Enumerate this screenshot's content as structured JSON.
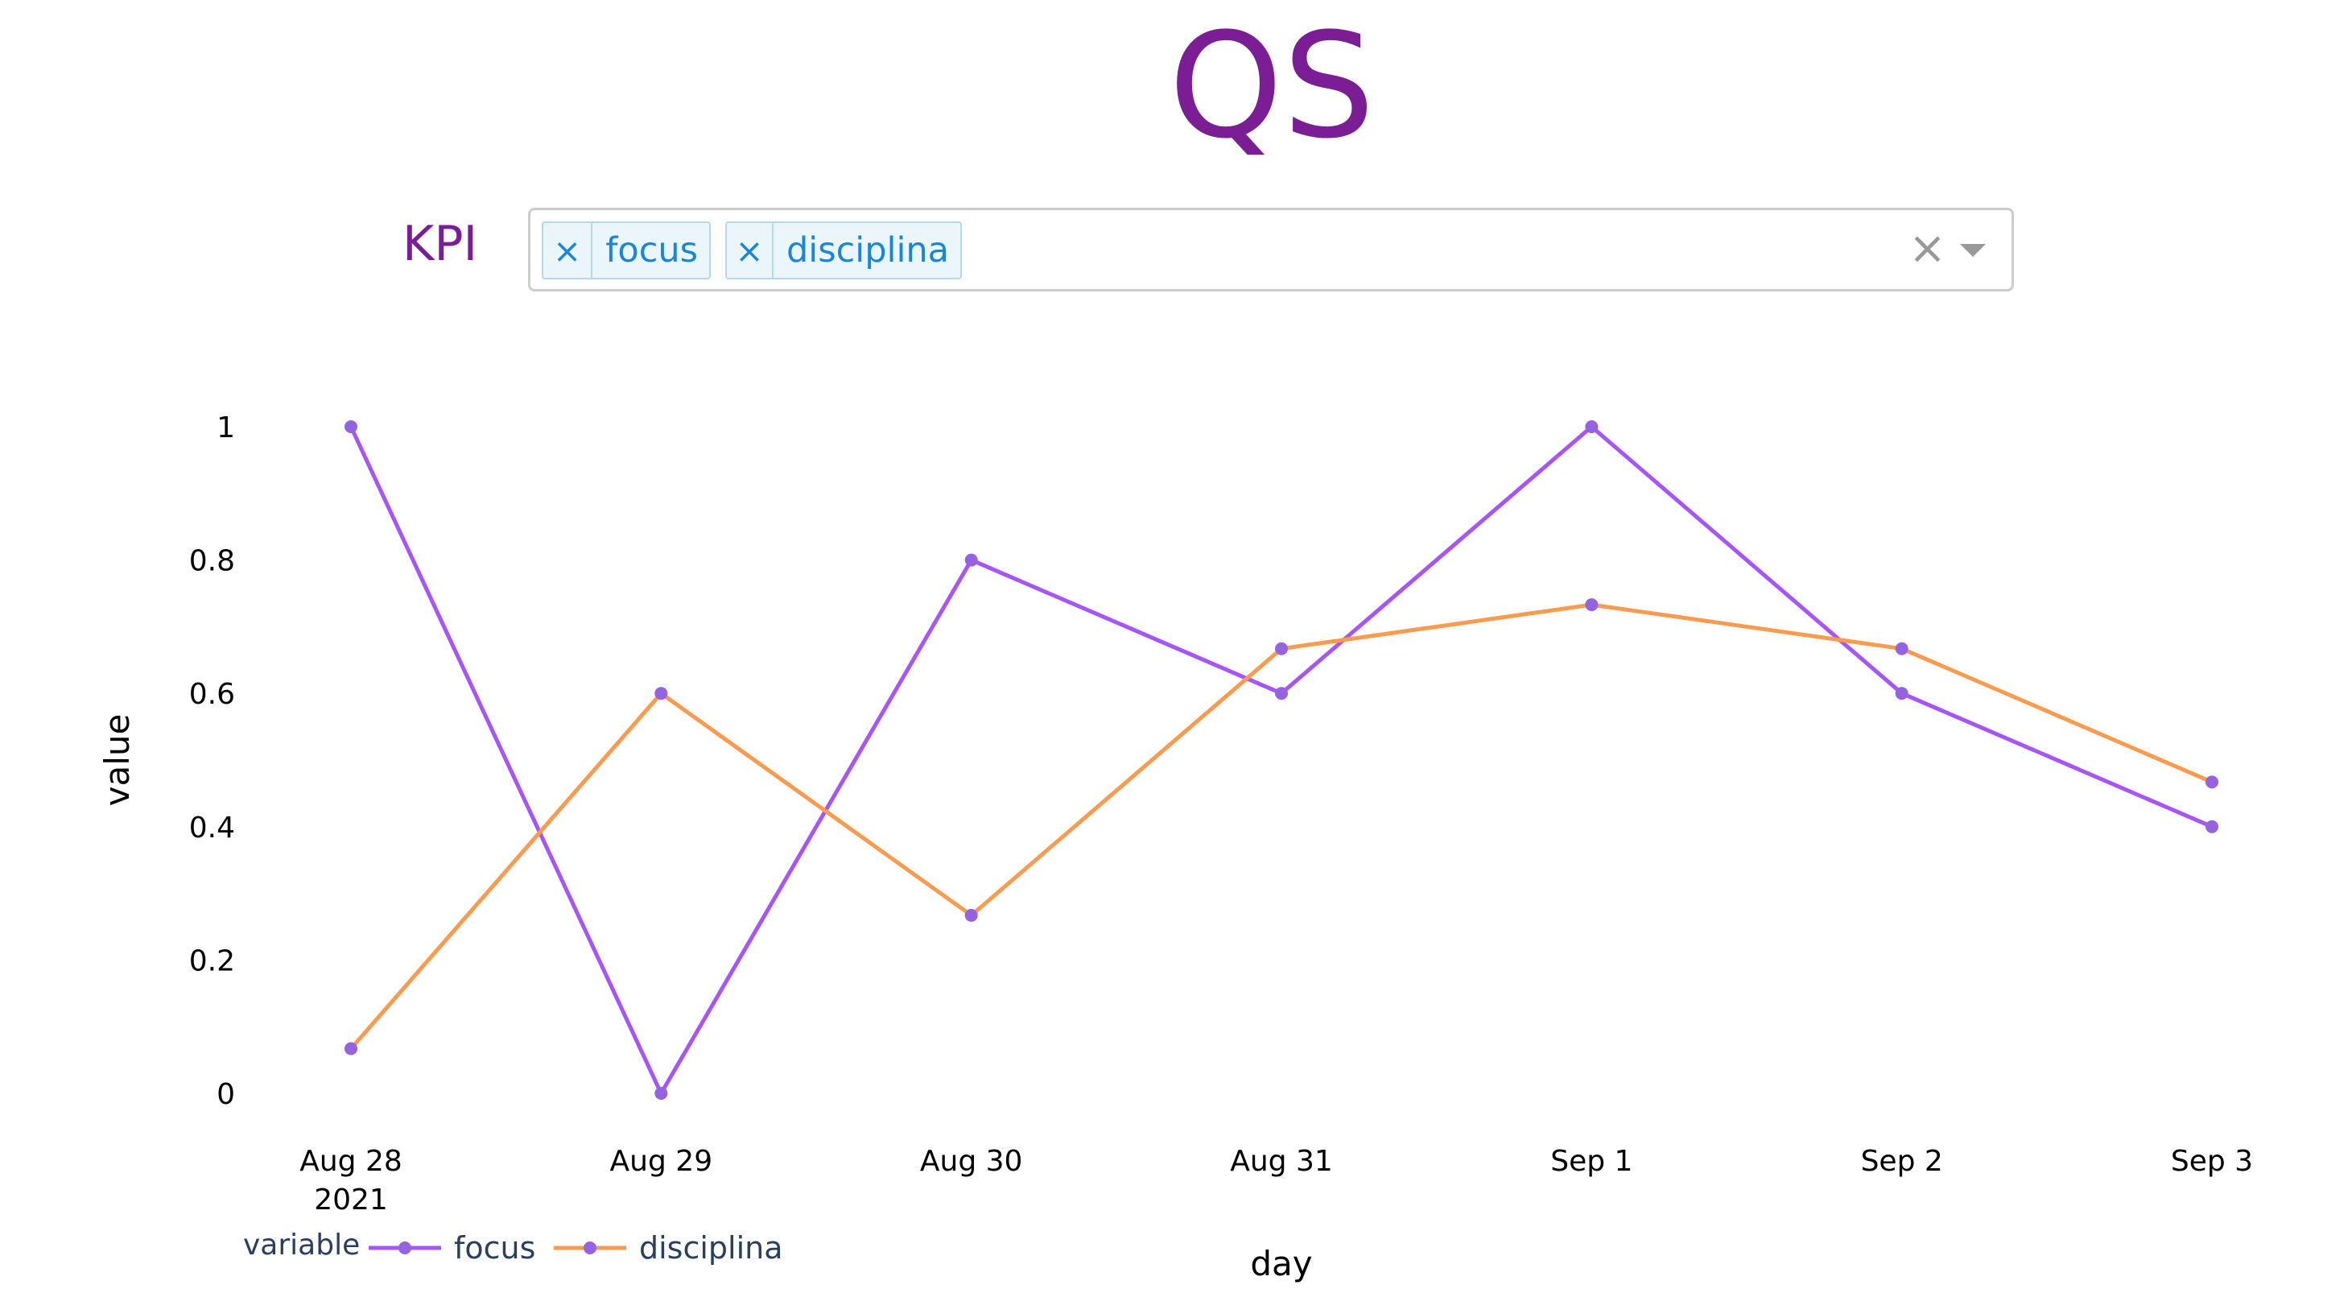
{
  "header": {
    "title": "QS"
  },
  "kpi_filter": {
    "label": "KPI",
    "selected": [
      {
        "label": "focus",
        "remove_glyph": "×"
      },
      {
        "label": "disciplina",
        "remove_glyph": "×"
      }
    ],
    "clear_glyph": "×",
    "clear_icon": "close-icon",
    "dropdown_icon": "caret-down-icon"
  },
  "chart_data": {
    "type": "line",
    "title": "",
    "xlabel": "day",
    "ylabel": "value",
    "categories": [
      "2021-08-28",
      "2021-08-29",
      "2021-08-30",
      "2021-08-31",
      "2021-09-01",
      "2021-09-02",
      "2021-09-03"
    ],
    "x_tick_labels": [
      "Aug 28",
      "Aug 29",
      "Aug 30",
      "Aug 31",
      "Sep 1",
      "Sep 2",
      "Sep 3"
    ],
    "x_tick_sublabel": "2021",
    "y_ticks": [
      0,
      0.2,
      0.4,
      0.6,
      0.8,
      1
    ],
    "y_tick_labels": [
      "0",
      "0.2",
      "0.4",
      "0.6",
      "0.8",
      "1"
    ],
    "ylim": [
      0,
      1
    ],
    "grid": false,
    "legend": {
      "title": "variable",
      "placement": "bottom-left",
      "orientation": "horizontal"
    },
    "series": [
      {
        "name": "focus",
        "color": "#a855f7",
        "values": [
          1.0,
          0.0,
          0.8,
          0.6,
          1.0,
          0.6,
          0.4
        ]
      },
      {
        "name": "disciplina",
        "color": "#fb9b4f",
        "values": [
          0.067,
          0.6,
          0.267,
          0.667,
          0.733,
          0.667,
          0.467
        ]
      }
    ],
    "marker_color": "#9562e0"
  }
}
